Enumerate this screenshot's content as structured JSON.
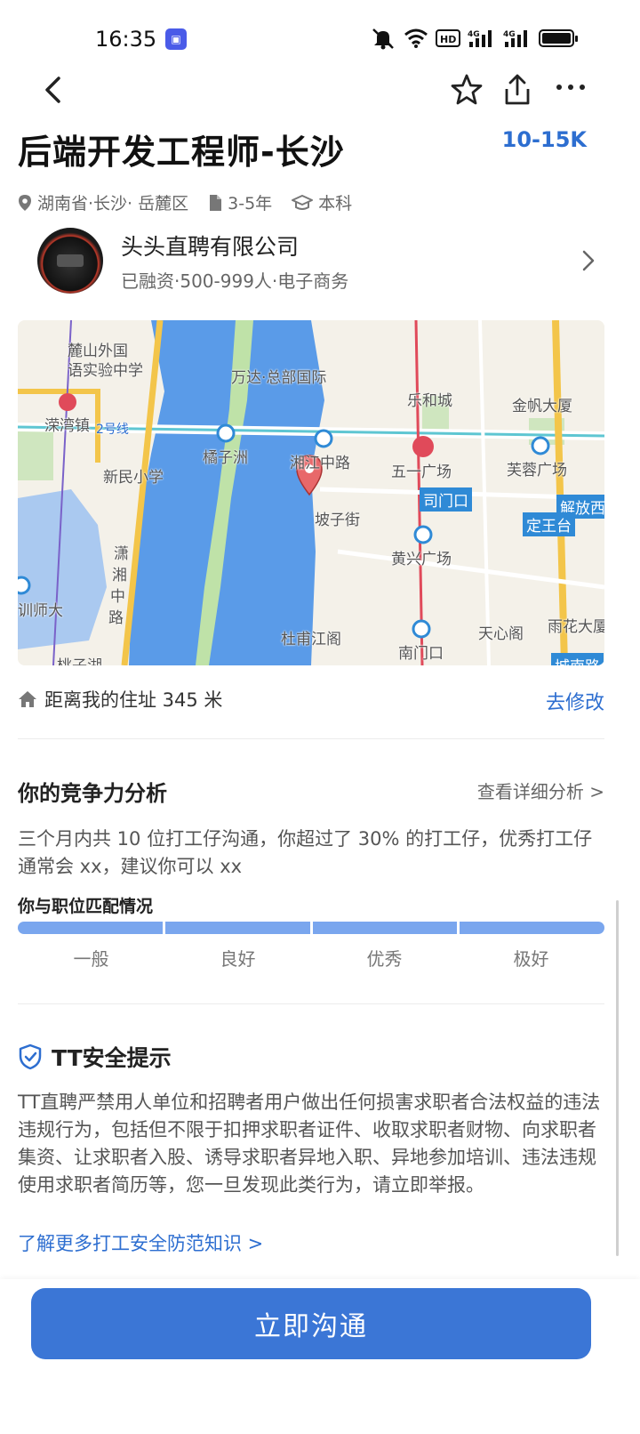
{
  "status_bar": {
    "time": "16:35",
    "app_badge": "▣",
    "hd_label": "HD",
    "network_labels": [
      "4G",
      "4G"
    ]
  },
  "nav": {
    "back_icon": "chevron-left-icon",
    "favorite_icon": "star-icon",
    "share_icon": "share-icon",
    "more_icon": "more-icon"
  },
  "job": {
    "title": "后端开发工程师-长沙",
    "salary": "10-15K",
    "location": "湖南省·长沙· 岳麓区",
    "experience": "3-5年",
    "education": "本科"
  },
  "company": {
    "name": "头头直聘有限公司",
    "info": "已融资·500-999人·电子商务"
  },
  "map": {
    "labels": [
      "麓山外国",
      "语实验中学",
      "万达·总部国际",
      "乐和城",
      "金帆大厦",
      "溁湾镇",
      "2号线",
      "橘子洲",
      "湘江中路",
      "五一广场",
      "芙蓉广场",
      "新民小学",
      "司门口",
      "解放西",
      "定王台",
      "坡子街",
      "黄兴广场",
      "潇",
      "湘",
      "中",
      "路",
      "训师大",
      "杜甫江阁",
      "天心阁",
      "雨花大厦",
      "南门口",
      "桃子湖",
      "城南路"
    ]
  },
  "distance": {
    "text": "距离我的住址 345 米",
    "edit_label": "去修改"
  },
  "competitiveness": {
    "title": "你的竞争力分析",
    "detail_link": "查看详细分析 >",
    "text": "三个月内共 10 位打工仔沟通，你超过了 30% 的打工仔，优秀打工仔通常会 xx，建议你可以 xx",
    "match_label": "你与职位匹配情况",
    "levels": [
      "一般",
      "良好",
      "优秀",
      "极好"
    ]
  },
  "safety": {
    "title": "TT安全提示",
    "text": "TT直聘严禁用人单位和招聘者用户做出任何损害求职者合法权益的违法违规行为，包括但不限于扣押求职者证件、收取求职者财物、向求职者集资、让求职者入股、诱导求职者异地入职、异地参加培训、违法违规使用求职者简历等，您一旦发现此类行为，请立即举报。",
    "link": "了解更多打工安全防范知识 >"
  },
  "cta": {
    "label": "立即沟通"
  },
  "colors": {
    "accent": "#3b76d6",
    "link": "#2d6ed0",
    "match_bar": "#7aa6ee",
    "river": "#5a9be8"
  }
}
